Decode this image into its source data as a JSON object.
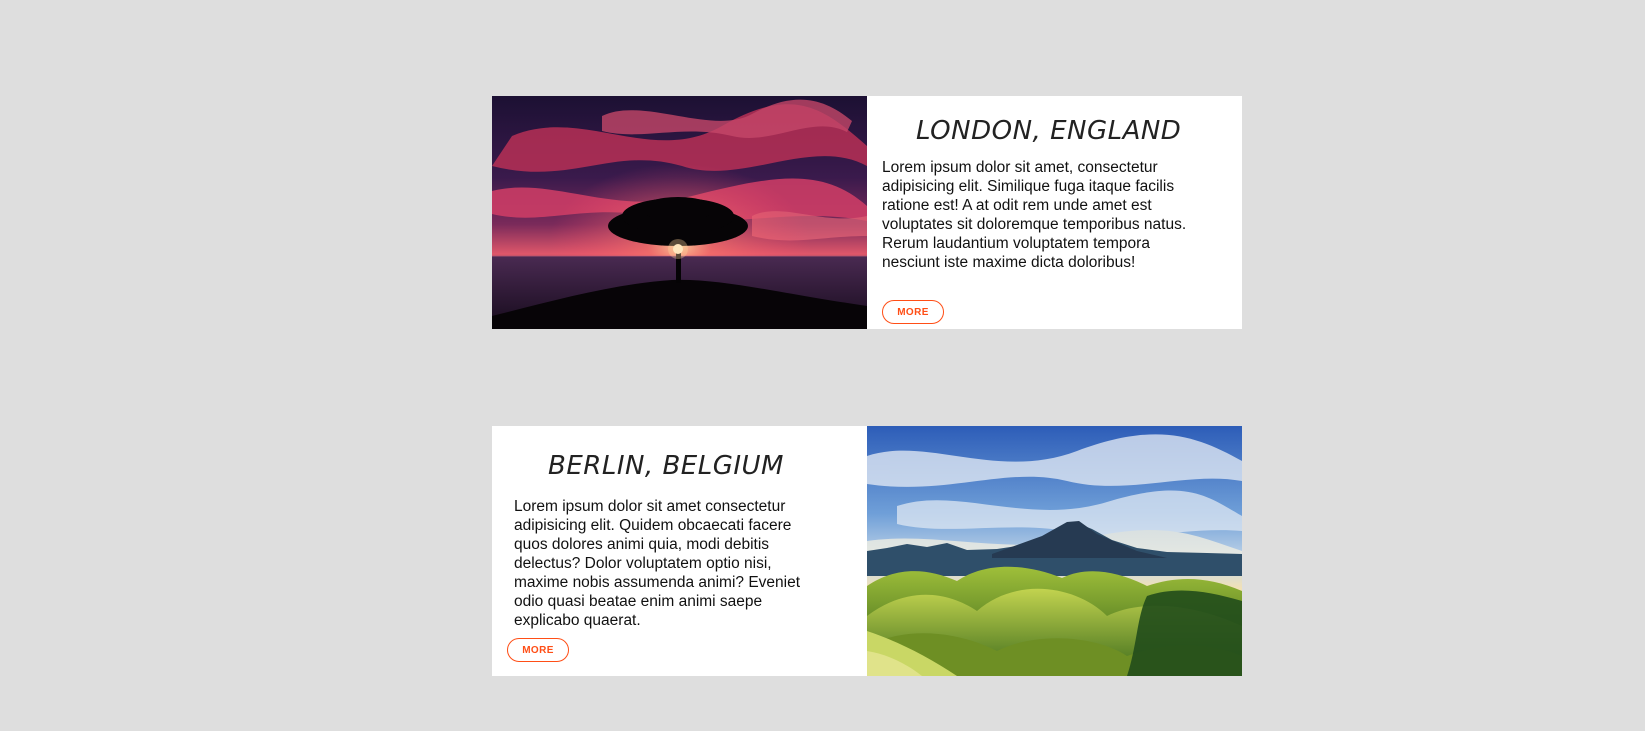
{
  "cards": [
    {
      "title": "LONDON, ENGLAND",
      "text": "Lorem ipsum dolor sit amet, consectetur adipisicing elit. Similique fuga itaque facilis ratione est! A at odit rem unde amet est voluptates sit doloremque temporibus natus. Rerum laudantium voluptatem tempora nesciunt iste maxime dicta doloribus!",
      "button": "MORE",
      "image": "sunset-tree-over-sea"
    },
    {
      "title": "BERLIN, BELGIUM",
      "text": "Lorem ipsum dolor sit amet consectetur adipisicing elit. Quidem obcaecati facere quos dolores animi quia, modi debitis delectus? Dolor voluptatem optio nisi, maxime nobis assumenda animi? Eveniet odio quasi beatae enim animi saepe explicabo quaerat.",
      "button": "MORE",
      "image": "green-hills-volcano"
    }
  ],
  "colors": {
    "page_background": "#dedede",
    "accent": "#ff4e16",
    "card_background": "#ffffff"
  }
}
